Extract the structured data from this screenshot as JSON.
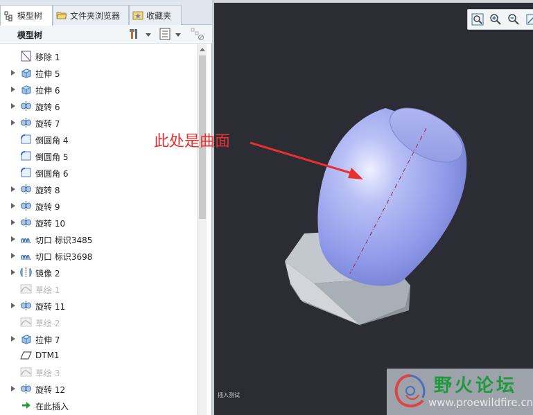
{
  "tabs": [
    {
      "label": "模型树",
      "icon": "model-tree-icon",
      "active": true
    },
    {
      "label": "文件夹浏览器",
      "icon": "folder-browser-icon",
      "active": false
    },
    {
      "label": "收藏夹",
      "icon": "favorites-icon",
      "active": false
    }
  ],
  "tree_header": {
    "title": "模型树"
  },
  "tree_rows": [
    {
      "label": "移除 1",
      "icon": "remove-icon",
      "expandable": false,
      "dim": false
    },
    {
      "label": "拉伸 5",
      "icon": "extrude-icon",
      "expandable": true,
      "dim": false
    },
    {
      "label": "拉伸 6",
      "icon": "extrude-icon",
      "expandable": true,
      "dim": false
    },
    {
      "label": "旋转 6",
      "icon": "revolve-icon",
      "expandable": true,
      "dim": false
    },
    {
      "label": "旋转 7",
      "icon": "revolve-icon",
      "expandable": true,
      "dim": false
    },
    {
      "label": "倒圆角 4",
      "icon": "round-icon",
      "expandable": false,
      "dim": false
    },
    {
      "label": "倒圆角 5",
      "icon": "round-icon",
      "expandable": false,
      "dim": false
    },
    {
      "label": "倒圆角 6",
      "icon": "round-icon",
      "expandable": false,
      "dim": false
    },
    {
      "label": "旋转 8",
      "icon": "revolve-icon",
      "expandable": true,
      "dim": false
    },
    {
      "label": "旋转 9",
      "icon": "revolve-icon",
      "expandable": true,
      "dim": false
    },
    {
      "label": "旋转 10",
      "icon": "revolve-icon",
      "expandable": true,
      "dim": false
    },
    {
      "label": "切口 标识3485",
      "icon": "cut-icon",
      "expandable": true,
      "dim": false
    },
    {
      "label": "切口 标识3698",
      "icon": "cut-icon",
      "expandable": true,
      "dim": false
    },
    {
      "label": "镜像 2",
      "icon": "mirror-icon",
      "expandable": true,
      "dim": false
    },
    {
      "label": "草绘 1",
      "icon": "sketch-icon",
      "expandable": false,
      "dim": true
    },
    {
      "label": "旋转 11",
      "icon": "revolve-icon",
      "expandable": true,
      "dim": false
    },
    {
      "label": "草绘 2",
      "icon": "sketch-icon",
      "expandable": false,
      "dim": true
    },
    {
      "label": "拉伸 7",
      "icon": "extrude-icon",
      "expandable": true,
      "dim": false
    },
    {
      "label": "DTM1",
      "icon": "datum-plane-icon",
      "expandable": false,
      "dim": false
    },
    {
      "label": "草绘 3",
      "icon": "sketch-icon",
      "expandable": false,
      "dim": true
    },
    {
      "label": "旋转 12",
      "icon": "revolve-icon",
      "expandable": true,
      "dim": false
    },
    {
      "label": "在此插入",
      "icon": "insert-here-icon",
      "expandable": false,
      "dim": false
    }
  ],
  "viewport": {
    "annotation": "此处是曲面",
    "status_text": "插入测试",
    "toolbar_icons": [
      "zoom-fit-icon",
      "zoom-in-icon",
      "zoom-out-icon",
      "view-icon"
    ]
  },
  "watermark": {
    "title": "野火论坛",
    "url": "www.proewildfire.cn"
  },
  "colors": {
    "viewport_bg": "#2c2c34",
    "body_fill": "#9aa4f0",
    "nut_fill": "#b7bcc3",
    "annotation": "#e83030",
    "watermark_green": "#1e9a3a"
  }
}
